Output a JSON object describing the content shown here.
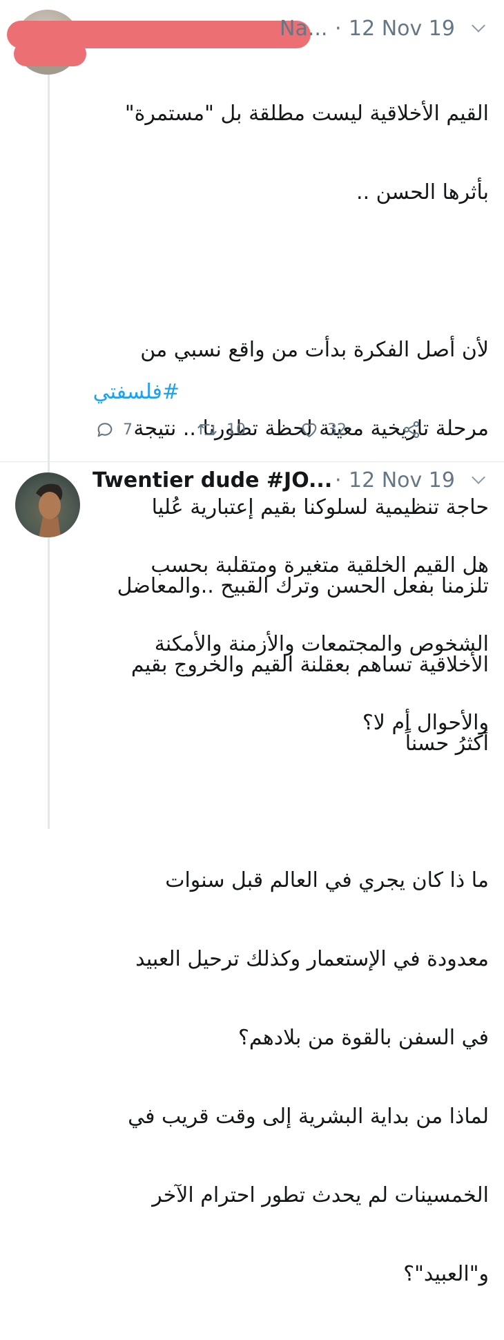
{
  "tweet1": {
    "author_visible": "Na...",
    "separator": "·",
    "date": "12 Nov 19",
    "text_lines": [
      "القيم الأخلاقية ليست مطلقة بل \"مستمرة\"",
      "بأثرها الحسن ..",
      "",
      "لأن أصل الفكرة بدأت من واقع نسبي من",
      "مرحلة تاريخية معينة لحظة تطورنا .. نتيجة",
      "حاجة تنظيمية لسلوكنا بقيم إعتبارية عُليا",
      "تلزمنا بفعل الحسن وترك القبيح ..والمعاضل",
      "الأخلاقية تساهم بعقلنة القيم والخروج بقيم",
      "أكثرُ حسناً"
    ],
    "hashtag": "#فلسفتي",
    "replies": "7",
    "retweets": "10",
    "likes": "32"
  },
  "tweet2": {
    "author": "Twentier dude #JO...",
    "separator": "·",
    "date": "12 Nov 19",
    "text_lines": [
      "هل القيم الخلقية متغيرة ومتقلبة بحسب",
      "الشخوص والمجتمعات والأزمنة والأمكنة",
      "والأحوال أم لا؟",
      "",
      "ما ذا كان يجري في العالم قبل سنوات",
      "معدودة في الإستعمار وكذلك ترحيل العبيد",
      "في السفن بالقوة من بلادهم؟",
      "لماذا من بداية البشرية إلى وقت قريب في",
      "الخمسينات لم يحدث تطور احترام الآخر",
      "و\"العبيد\"؟"
    ]
  },
  "colors": {
    "text": "#14171a",
    "secondary": "#657786",
    "link": "#1da1f2",
    "redaction": "#ec6f73",
    "thread_line": "#e1e8ed"
  },
  "icons": [
    "reply-icon",
    "retweet-icon",
    "like-icon",
    "share-icon",
    "chevron-down-icon"
  ]
}
